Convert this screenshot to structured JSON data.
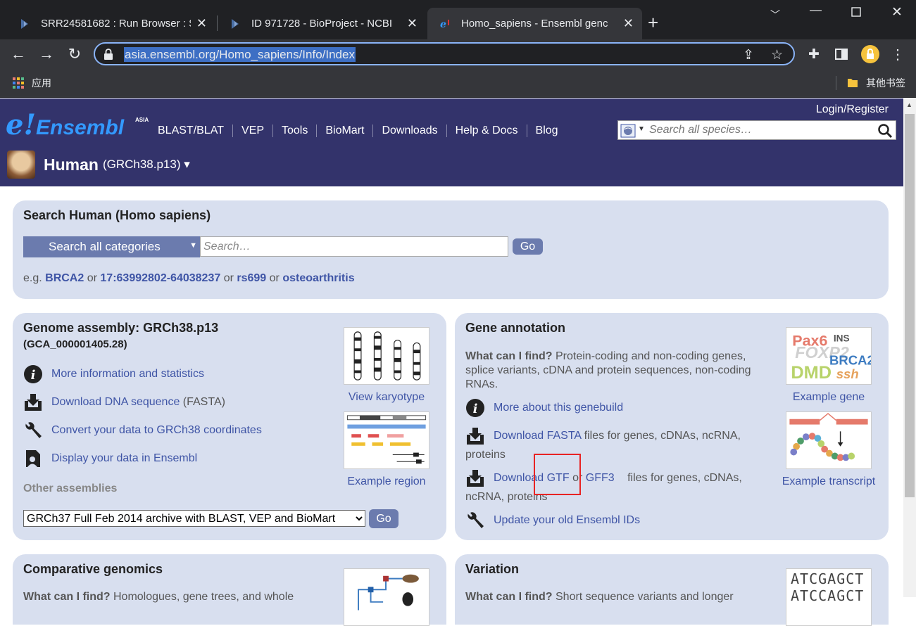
{
  "browser": {
    "tabs": [
      {
        "title": "SRR24581682 : Run Browser : S",
        "active": false
      },
      {
        "title": "ID 971728 - BioProject - NCBI",
        "active": false
      },
      {
        "title": "Homo_sapiens - Ensembl genc",
        "active": true
      }
    ],
    "url": "asia.ensembl.org/Homo_sapiens/Info/Index",
    "bookmarks": {
      "apps": "应用",
      "other": "其他书签"
    }
  },
  "header": {
    "logo_e": "e!",
    "logo_name": "Ensembl",
    "logo_asia": "ASIA",
    "nav": [
      "BLAST/BLAT",
      "VEP",
      "Tools",
      "BioMart",
      "Downloads",
      "Help & Docs",
      "Blog"
    ],
    "login": "Login/Register",
    "search_placeholder": "Search all species…",
    "species": "Human",
    "assembly": "(GRCh38.p13) ▾"
  },
  "search_panel": {
    "title": "Search Human (Homo sapiens)",
    "category": "Search all categories",
    "placeholder": "Search…",
    "go": "Go",
    "eg_prefix": "e.g.",
    "examples": [
      "BRCA2",
      "17:63992802-64038237",
      "rs699",
      "osteoarthritis"
    ],
    "or": "or"
  },
  "genome_panel": {
    "title": "Genome assembly: GRCh38.p13",
    "accession": "(GCA_000001405.28)",
    "links": [
      {
        "icon": "info-icon",
        "text": "More information and statistics",
        "suffix": ""
      },
      {
        "icon": "download-icon",
        "text": "Download DNA sequence",
        "suffix": " (FASTA)"
      },
      {
        "icon": "wrench-icon",
        "text": "Convert your data to GRCh38 coordinates",
        "suffix": ""
      },
      {
        "icon": "user-data-icon",
        "text": "Display your data in Ensembl",
        "suffix": ""
      }
    ],
    "other_assemblies": "Other assemblies",
    "assembly_option": "GRCh37 Full Feb 2014 archive with BLAST, VEP and BioMart",
    "go": "Go",
    "karyotype_caption": "View karyotype",
    "region_caption": "Example region"
  },
  "gene_panel": {
    "title": "Gene annotation",
    "find_label": "What can I find?",
    "find_text": " Protein-coding and non-coding genes, splice variants, cDNA and protein sequences, non-coding RNAs.",
    "genebuild_link": "More about this genebuild",
    "fasta_link": "Download FASTA",
    "fasta_text": " files for genes, cDNAs, ncRNA,",
    "fasta_text2": "proteins",
    "gtf_prefix": "Download",
    "gtf_link": "GTF",
    "gtf_or": "or",
    "gff3_link": "GFF3",
    "gtf_text": "files for genes, cDNAs,",
    "gtf_text2": "ncRNA, proteins",
    "update_link": "Update your old Ensembl IDs",
    "example_gene_caption": "Example gene",
    "example_transcript_caption": "Example transcript",
    "gene_image_words": [
      "Pax6",
      "INS",
      "FOXP2",
      "BRCA2",
      "DMD",
      "ssh"
    ]
  },
  "comparative_panel": {
    "title": "Comparative genomics",
    "find_label": "What can I find?",
    "find_text": " Homologues, gene trees, and whole"
  },
  "variation_panel": {
    "title": "Variation",
    "find_label": "What can I find?",
    "find_text": " Short sequence variants and longer",
    "seq1": "ATCGAGCT",
    "seq2": "ATCCAGCT"
  },
  "colors": {
    "header_bg": "#33336b",
    "panel_bg": "#d8dfef",
    "link": "#3f55a6",
    "highlight_box": "#e82323"
  }
}
